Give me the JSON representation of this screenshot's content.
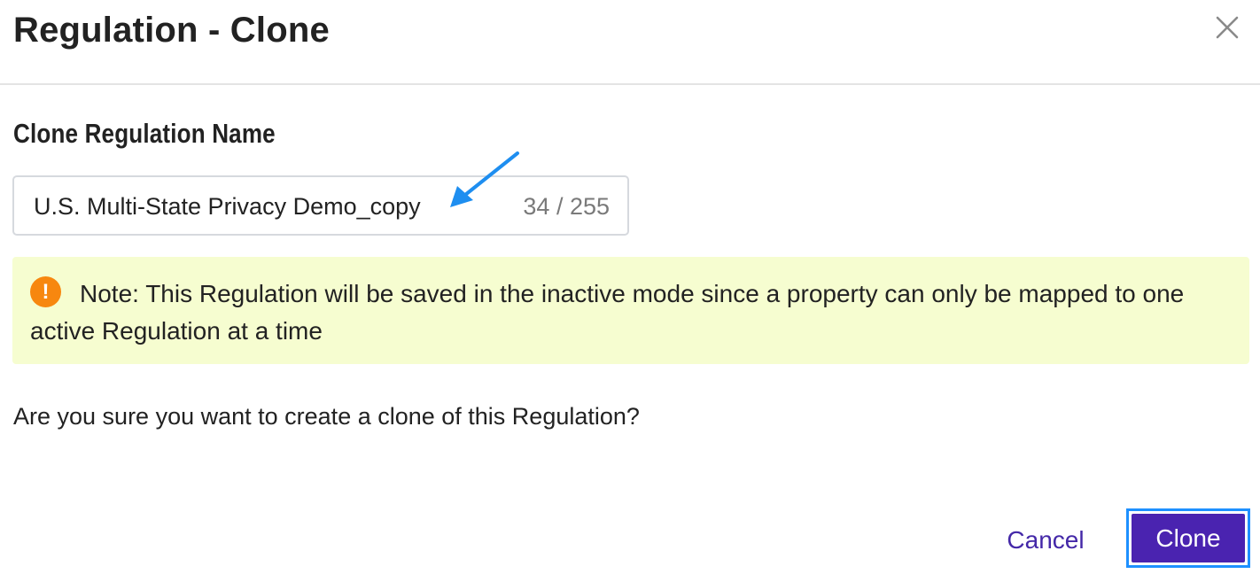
{
  "dialog": {
    "title": "Regulation - Clone",
    "close_icon": "close-icon"
  },
  "form": {
    "label": "Clone Regulation Name",
    "name_value": "U.S. Multi-State Privacy Demo_copy",
    "char_count": "34 / 255"
  },
  "note": {
    "icon": "warning-icon",
    "icon_glyph": "!",
    "text": "Note: This Regulation will be saved in the inactive mode since a property can only be mapped to one active Regulation at a time",
    "background_color": "#f6fdd0",
    "icon_color": "#f7870f"
  },
  "confirm": {
    "text": "Are you sure you want to create a clone of this Regulation?"
  },
  "footer": {
    "cancel_label": "Cancel",
    "clone_label": "Clone",
    "primary_color": "#4a23b0",
    "focus_color": "#1e90ff",
    "link_color": "#4428a8"
  },
  "annotation": {
    "arrow_icon": "annotation-arrow-icon",
    "arrow_color": "#1e8ef0"
  }
}
